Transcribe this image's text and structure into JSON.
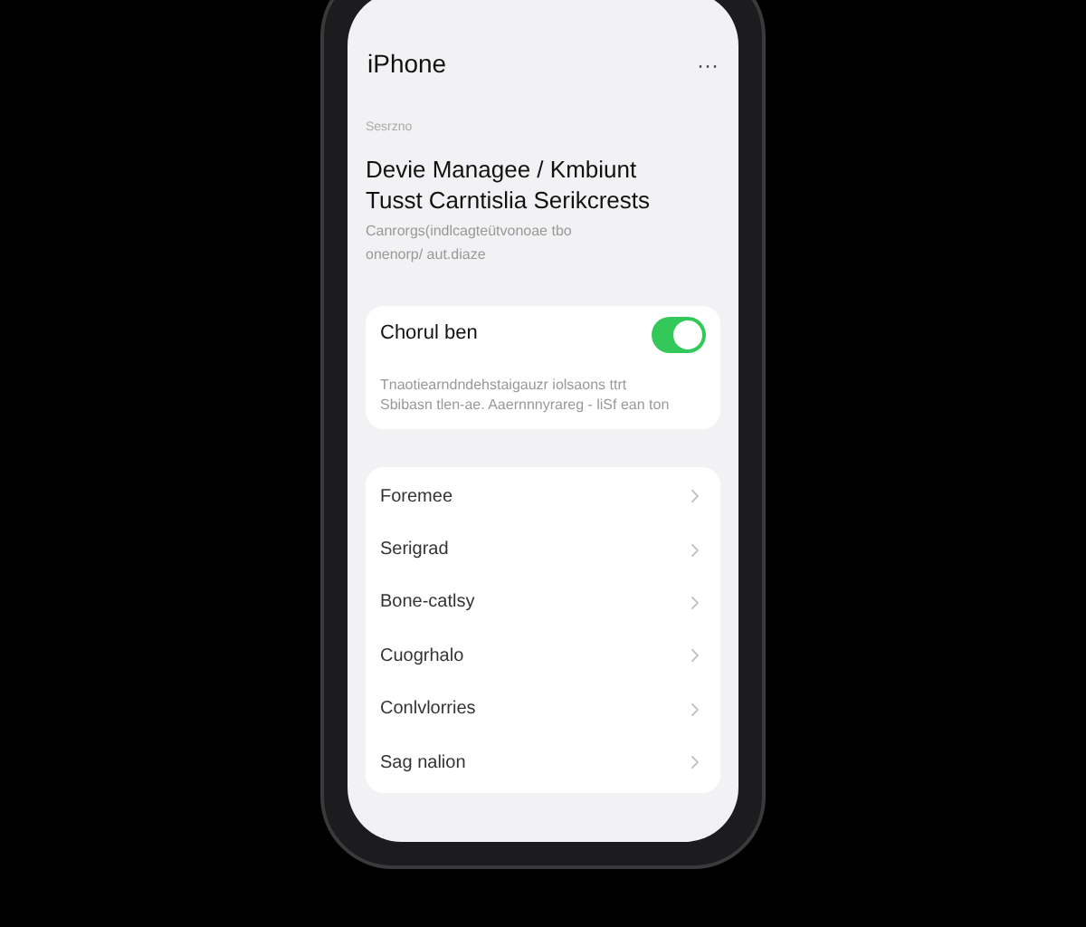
{
  "header": {
    "title": "iPhone",
    "more": "···"
  },
  "section_label": "Sesrzno",
  "title_lines": [
    "Devie Managee / Kmbiunt",
    "Tusst Carntislia Serikcrests"
  ],
  "caption_lines": [
    "Canrorgs(indlcagteütvonoae tbo",
    "onenorp/ aut.diaze"
  ],
  "toggle_card": {
    "label": "Chorul ben",
    "on": true,
    "description_lines": [
      "Tnaotiearndndehstaigauzr iolsaons ttrt",
      "Sbibasn tlen-ae. Aaernnnyrareg - liSf ean ton"
    ]
  },
  "menu_items": [
    {
      "label": "Foremee"
    },
    {
      "label": "Serigrad"
    },
    {
      "label": "Bone-catlsy"
    },
    {
      "label": "Cuogrhalo"
    },
    {
      "label": "Conlvlorries"
    },
    {
      "label": "Sag nalion"
    }
  ]
}
